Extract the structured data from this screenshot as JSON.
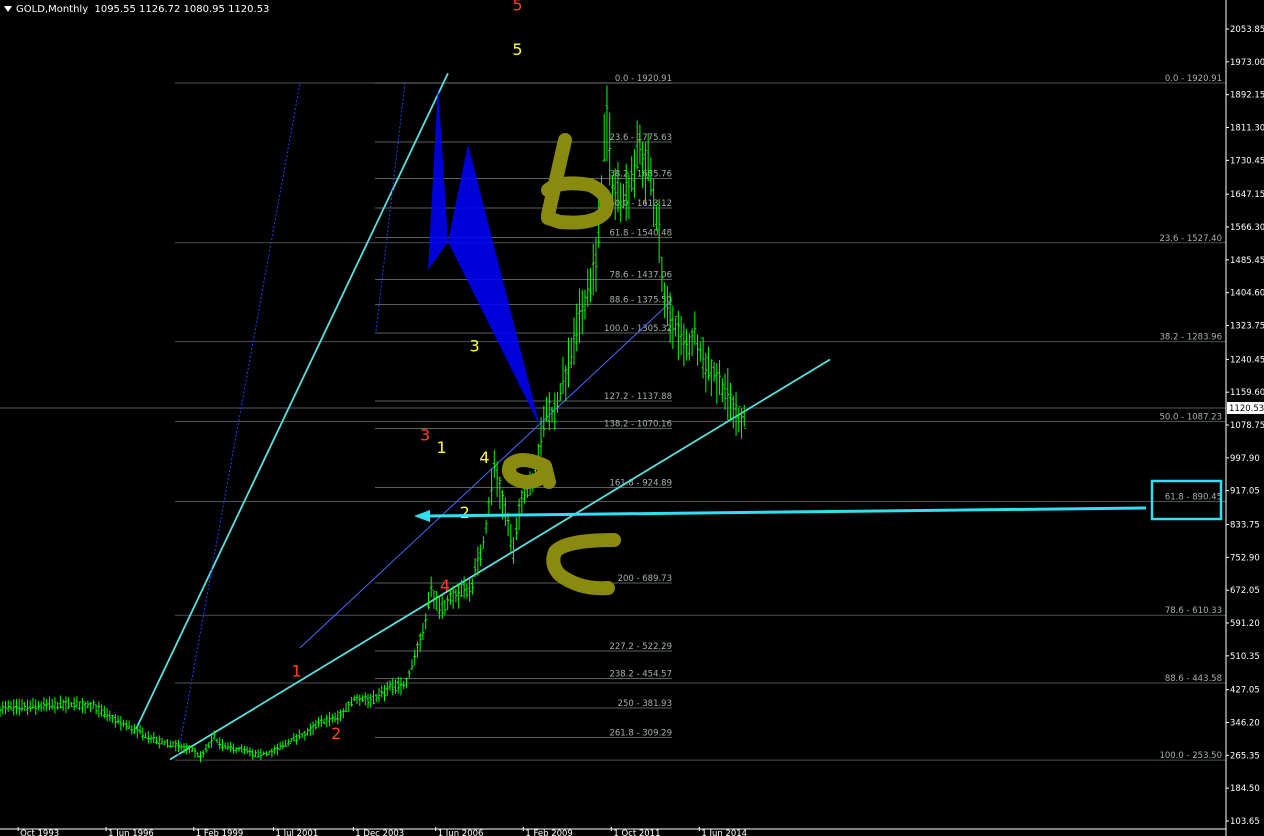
{
  "header": {
    "symbol": "GOLD,Monthly",
    "ohlc": "1095.55 1126.72 1080.95 1120.53"
  },
  "colors": {
    "background": "#000000",
    "candle": "#00ff00",
    "axis": "#ffffff",
    "fib": "#7f8a8a",
    "trend_cyan": "#5be0e0",
    "trend_blue": "#2040ff",
    "pattern_fill": "#0000ff",
    "wave_red": "#ff4020",
    "wave_yellow": "#ffff30",
    "handwriting": "#8a8a10",
    "arrow": "#30e0f0"
  },
  "chart_data": {
    "type": "candlestick",
    "title": "GOLD,Monthly",
    "ylim": [
      103.65,
      2100
    ],
    "y_ticks": [
      "2053.85",
      "1973.00",
      "1892.15",
      "1811.30",
      "1730.45",
      "1647.15",
      "1566.30",
      "1485.45",
      "1404.60",
      "1323.75",
      "1240.45",
      "1159.60",
      "1078.75",
      "997.90",
      "917.05",
      "833.75",
      "752.90",
      "672.05",
      "591.20",
      "510.35",
      "427.05",
      "346.20",
      "265.35",
      "184.50",
      "103.65"
    ],
    "x_ticks": [
      "Oct 1993",
      "1 Jun 1996",
      "1 Feb 1999",
      "1 Jul 2001",
      "1 Dec 2003",
      "1 Jun 2006",
      "1 Feb 2009",
      "1 Oct 2011",
      "1 Jun 2014"
    ],
    "x_tick_years": [
      1993.75,
      1996.42,
      1999.08,
      2001.5,
      2003.92,
      2006.42,
      2009.08,
      2011.75,
      2014.42
    ],
    "x_year_range": [
      1993.2,
      2030.4
    ],
    "last_price": "1120.53",
    "price_path": [
      [
        1993.2,
        380
      ],
      [
        1994,
        385
      ],
      [
        1995,
        390
      ],
      [
        1996,
        390
      ],
      [
        1996.5,
        360
      ],
      [
        1997,
        340
      ],
      [
        1997.5,
        320
      ],
      [
        1998,
        300
      ],
      [
        1998.5,
        290
      ],
      [
        1999,
        280
      ],
      [
        1999.3,
        260
      ],
      [
        1999.7,
        310
      ],
      [
        2000,
        285
      ],
      [
        2000.5,
        280
      ],
      [
        2001,
        265
      ],
      [
        2001.5,
        275
      ],
      [
        2002,
        300
      ],
      [
        2002.5,
        320
      ],
      [
        2003,
        350
      ],
      [
        2003.5,
        360
      ],
      [
        2004,
        410
      ],
      [
        2004.5,
        400
      ],
      [
        2005,
        430
      ],
      [
        2005.5,
        440
      ],
      [
        2006,
        560
      ],
      [
        2006.3,
        680
      ],
      [
        2006.5,
        620
      ],
      [
        2007,
        660
      ],
      [
        2007.5,
        680
      ],
      [
        2007.9,
        800
      ],
      [
        2008.2,
        980
      ],
      [
        2008.5,
        880
      ],
      [
        2008.8,
        760
      ],
      [
        2009,
        900
      ],
      [
        2009.4,
        950
      ],
      [
        2009.8,
        1120
      ],
      [
        2010,
        1100
      ],
      [
        2010.5,
        1240
      ],
      [
        2010.9,
        1380
      ],
      [
        2011.3,
        1480
      ],
      [
        2011.6,
        1850
      ],
      [
        2011.8,
        1650
      ],
      [
        2012.2,
        1650
      ],
      [
        2012.6,
        1750
      ],
      [
        2012.9,
        1700
      ],
      [
        2013.2,
        1550
      ],
      [
        2013.4,
        1350
      ],
      [
        2013.7,
        1320
      ],
      [
        2014,
        1260
      ],
      [
        2014.3,
        1300
      ],
      [
        2014.6,
        1230
      ],
      [
        2014.9,
        1200
      ],
      [
        2015.2,
        1170
      ],
      [
        2015.5,
        1110
      ],
      [
        2015.8,
        1090
      ]
    ],
    "fib_left": [
      {
        "label": "0.0 - 1920.91",
        "price": 1920.91
      },
      {
        "label": "23.6 - 1775.63",
        "price": 1775.63
      },
      {
        "label": "38.2 - 1685.76",
        "price": 1685.76
      },
      {
        "label": "50.0 - 1613.12",
        "price": 1613.12
      },
      {
        "label": "61.8 - 1540.48",
        "price": 1540.48
      },
      {
        "label": "78.6 - 1437.06",
        "price": 1437.06
      },
      {
        "label": "88.6 - 1375.50",
        "price": 1375.5
      },
      {
        "label": "100.0 - 1305.32",
        "price": 1305.32
      },
      {
        "label": "127.2 - 1137.88",
        "price": 1137.88
      },
      {
        "label": "138.2 - 1070.16",
        "price": 1070.16
      },
      {
        "label": "161.8 - 924.89",
        "price": 924.89
      },
      {
        "label": "200 - 689.73",
        "price": 689.73
      },
      {
        "label": "227.2 - 522.29",
        "price": 522.29
      },
      {
        "label": "238.2 - 454.57",
        "price": 454.57
      },
      {
        "label": "250 - 381.93",
        "price": 381.93
      },
      {
        "label": "261.8 - 309.29",
        "price": 309.29
      }
    ],
    "fib_right": [
      {
        "label": "0.0 - 1920.91",
        "price": 1920.91
      },
      {
        "label": "23.6 - 1527.40",
        "price": 1527.4
      },
      {
        "label": "38.2 - 1283.96",
        "price": 1283.96
      },
      {
        "label": "50.0 - 1087.23",
        "price": 1087.23
      },
      {
        "label": "61.8 - 890.45",
        "price": 890.45
      },
      {
        "label": "78.6 - 610.33",
        "price": 610.33
      },
      {
        "label": "88.6 - 443.58",
        "price": 443.58
      },
      {
        "label": "100.0 - 253.50",
        "price": 253.5
      }
    ],
    "wave_labels": [
      {
        "text": "5",
        "color": "red",
        "year": 2008.9,
        "price": 2100
      },
      {
        "text": "5",
        "color": "yellow",
        "year": 2008.9,
        "price": 1990
      },
      {
        "text": "3",
        "color": "red",
        "year": 2006.1,
        "price": 1040
      },
      {
        "text": "4",
        "color": "red",
        "year": 2006.7,
        "price": 670
      },
      {
        "text": "1",
        "color": "red",
        "year": 2002.2,
        "price": 460
      },
      {
        "text": "2",
        "color": "red",
        "year": 2003.4,
        "price": 305
      },
      {
        "text": "3",
        "color": "yellow",
        "year": 2007.6,
        "price": 1260
      },
      {
        "text": "1",
        "color": "yellow",
        "year": 2006.6,
        "price": 1010
      },
      {
        "text": "4",
        "color": "yellow",
        "year": 2007.9,
        "price": 985
      },
      {
        "text": "2",
        "color": "yellow",
        "year": 2007.3,
        "price": 850
      }
    ],
    "annotations": {
      "price_tag": "1120.53"
    }
  }
}
